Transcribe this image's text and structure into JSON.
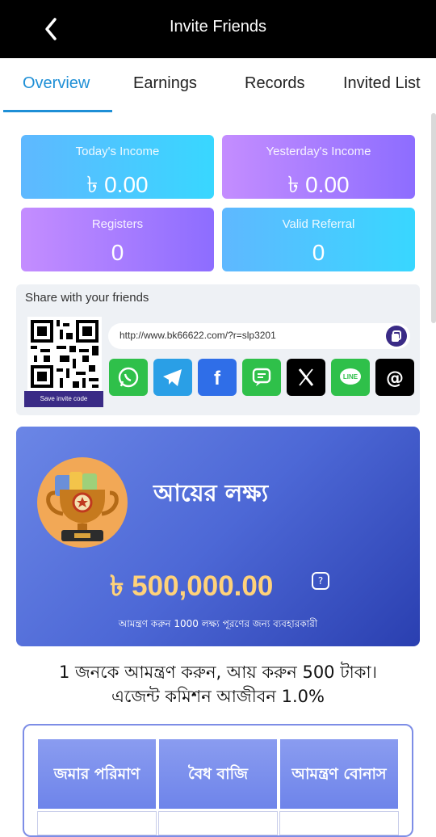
{
  "header": {
    "title": "Invite Friends"
  },
  "tabs": [
    {
      "label": "Overview"
    },
    {
      "label": "Earnings"
    },
    {
      "label": "Records"
    },
    {
      "label": "Invited List"
    }
  ],
  "stats": {
    "today": {
      "label": "Today's Income",
      "value": "৳ 0.00"
    },
    "yesterday": {
      "label": "Yesterday's Income",
      "value": "৳ 0.00"
    },
    "registers": {
      "label": "Registers",
      "value": "0"
    },
    "valid": {
      "label": "Valid Referral",
      "value": "0"
    }
  },
  "share": {
    "title": "Share with your friends",
    "save_label": "Save invite code",
    "link": "http://www.bk66622.com/?r=slp3201",
    "socials": [
      "whatsapp-icon",
      "telegram-icon",
      "facebook-icon",
      "sms-icon",
      "x-icon",
      "line-icon",
      "threads-icon"
    ]
  },
  "goal": {
    "title": "আয়ের লক্ষ্য",
    "amount": "৳ 500,000.00",
    "note": "আমন্ত্রণ করুন 1000 লক্ষ্য পূরণের জন্য ব্যবহারকারী"
  },
  "invite": {
    "line1": "1 জনকে আমন্ত্রণ করুন, আয় করুন 500 টাকা।",
    "line2": "এজেন্ট কমিশন আজীবন 1.0%"
  },
  "table": {
    "headers": [
      "জমার পরিমাণ",
      "বৈধ বাজি",
      "আমন্ত্রণ বোনাস"
    ]
  },
  "colors": {
    "accent": "#1e8fd6",
    "brand_dark": "#3a2b86",
    "gold": "#ffd27a"
  }
}
